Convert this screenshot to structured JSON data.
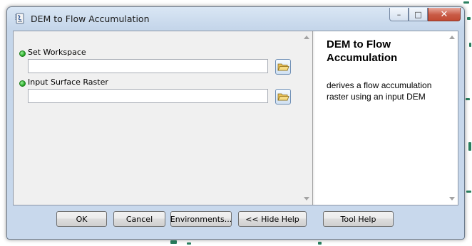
{
  "window": {
    "title": "DEM to Flow Accumulation",
    "controls": {
      "minimize": "–",
      "maximize": "□",
      "close": "✕"
    }
  },
  "parameters": [
    {
      "label": "Set Workspace",
      "value": "",
      "required": true
    },
    {
      "label": "Input Surface Raster",
      "value": "",
      "required": true
    }
  ],
  "help": {
    "title": "DEM to Flow Accumulation",
    "body": "derives a flow accumulation raster using an input DEM"
  },
  "buttons": {
    "ok": "OK",
    "cancel": "Cancel",
    "environments": "Environments...",
    "hide_help": "<< Hide Help",
    "tool_help": "Tool Help"
  },
  "colors": {
    "required_dot": "#1fa31f",
    "close_button": "#c85a45"
  },
  "icons": {
    "app": "script-tool-icon",
    "browse": "open-folder-icon"
  }
}
